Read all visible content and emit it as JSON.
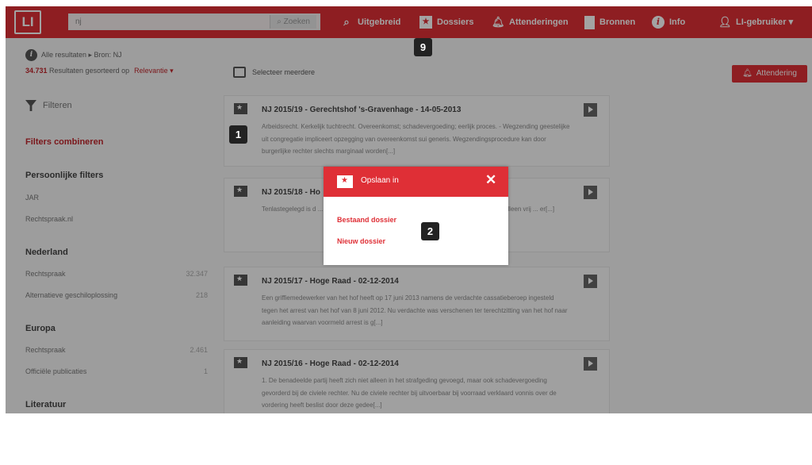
{
  "header": {
    "logo": "LI",
    "search_value": "nj",
    "search_button": "Zoeken",
    "nav": {
      "uitgebreid": "Uitgebreid",
      "dossiers": "Dossiers",
      "attenderingen": "Attenderingen",
      "bronnen": "Bronnen",
      "info": "Info",
      "user": "LI-gebruiker ▾"
    }
  },
  "subbar": {
    "breadcrumb": "Alle resultaten  ▸  Bron: NJ",
    "results_count": "34.731",
    "results_text": " Resultaten gesorteerd op",
    "sort": "Relevantie ▾",
    "select_multiple": "Selecteer meerdere",
    "attendering": "Attendering"
  },
  "sidebar": {
    "filter_label": "Filteren",
    "combine": "Filters combineren",
    "sections": [
      {
        "title": "Persoonlijke filters",
        "items": [
          {
            "label": "JAR",
            "count": ""
          },
          {
            "label": "Rechtspraak.nl",
            "count": ""
          }
        ]
      },
      {
        "title": "Nederland",
        "items": [
          {
            "label": "Rechtspraak",
            "count": "32.347"
          },
          {
            "label": "Alternatieve geschiloplossing",
            "count": "218"
          }
        ]
      },
      {
        "title": "Europa",
        "items": [
          {
            "label": "Rechtspraak",
            "count": "2.461"
          },
          {
            "label": "Officiële publicaties",
            "count": "1"
          }
        ]
      },
      {
        "title": "Literatuur",
        "items": []
      }
    ]
  },
  "results": [
    {
      "title": "NJ 2015/19 - Gerechtshof 's-Gravenhage - 14-05-2013",
      "snippet": "Arbeidsrecht. Kerkelijk tuchtrecht. Overeenkomst; schadevergoeding; eerlijk proces. - Wegzending geestelijke uit congregatie impliceert opzegging van overeenkomst sui generis. Wegzendingsprocedure kan door burgerlijke rechter slechts marginaal worden[...]"
    },
    {
      "title": "NJ 2015/18 - Ho",
      "snippet": "Tenlastegelegd is d ... van alcohol heeft gereden (art. 8 lid ... er is, spreekt het hof niet alleen vrij ... er[...]"
    },
    {
      "title": "NJ 2015/17 - Hoge Raad - 02-12-2014",
      "snippet": "Een griffiemedewerker van het hof heeft op 17 juni 2013 namens de verdachte cassatieberoep ingesteld tegen het arrest van het hof van 8 juni 2012. Nu verdachte was verschenen ter terechtzitting van het hof naar aanleiding waarvan voormeld arrest is g[...]"
    },
    {
      "title": "NJ 2015/16 - Hoge Raad - 02-12-2014",
      "snippet": "1. De benadeelde partij heeft zich niet alleen in het strafgeding gevoegd, maar ook schadevergoeding gevorderd bij de civiele rechter. Nu de civiele rechter bij uitvoerbaar bij voorraad verklaard vonnis over de vordering heeft beslist door deze gedee[...]"
    }
  ],
  "modal": {
    "title": "Opslaan in",
    "close": "✕",
    "existing": "Bestaand dossier",
    "new": "Nieuw dossier"
  },
  "badges": {
    "b1": "1",
    "b2": "2",
    "b9": "9"
  },
  "colors": {
    "brand": "#df2f36"
  }
}
